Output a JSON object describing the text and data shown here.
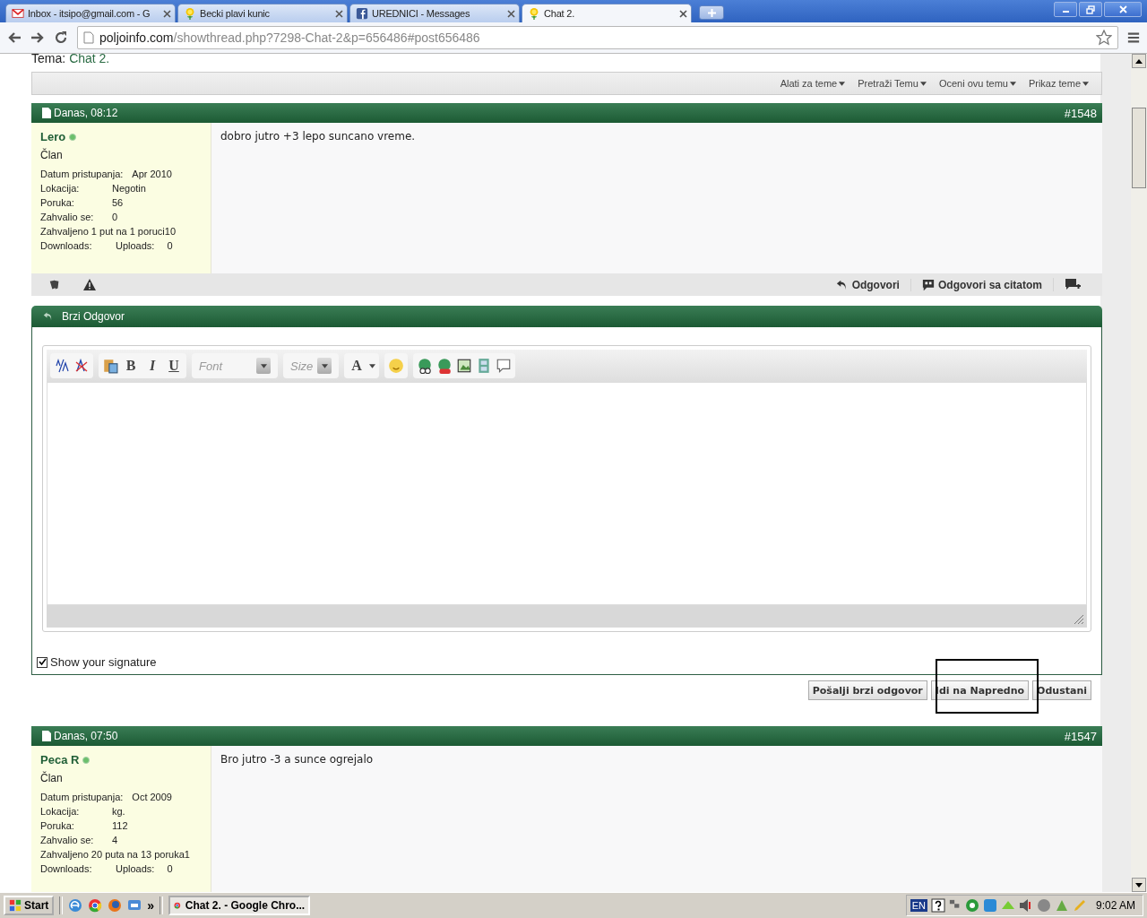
{
  "browser": {
    "tabs": [
      {
        "title": "Inbox - itsipo@gmail.com - G",
        "kind": "mail",
        "selected": false
      },
      {
        "title": "Becki plavi kunic",
        "kind": "flower",
        "selected": false
      },
      {
        "title": "UREDNICI - Messages",
        "kind": "facebook",
        "selected": false
      },
      {
        "title": "Chat 2.",
        "kind": "flower",
        "selected": true
      }
    ],
    "address": {
      "domain": "poljoinfo.com",
      "path": "/showthread.php?7298-Chat-2&p=656486#post656486"
    }
  },
  "thread": {
    "label": "Tema:",
    "title": "Chat 2."
  },
  "thread_tools": [
    "Alati za teme",
    "Pretraži Temu",
    "Oceni ovu temu",
    "Prikaz teme"
  ],
  "posts": [
    {
      "date": "Danas, 08:12",
      "number": "#1548",
      "author": "Lero",
      "online": true,
      "rank": "Član",
      "stats": [
        [
          "Datum pristupanja:",
          "Apr 2010"
        ],
        [
          "Lokacija:",
          "Negotin"
        ],
        [
          "Poruka:",
          "56"
        ],
        [
          "Zahvalio se:",
          "0"
        ],
        [
          "Zahvaljeno 1 put na 1 poruci10"
        ],
        [
          "Downloads:",
          "Uploads:",
          "0"
        ]
      ],
      "message": "dobro jutro +3 lepo suncano vreme.",
      "actions": [
        "Odgovori",
        "Odgovori sa citatom"
      ]
    },
    {
      "date": "Danas, 07:50",
      "number": "#1547",
      "author": "Peca R",
      "online": true,
      "rank": "Član",
      "stats": [
        [
          "Datum pristupanja:",
          "Oct 2009"
        ],
        [
          "Lokacija:",
          "kg."
        ],
        [
          "Poruka:",
          "112"
        ],
        [
          "Zahvalio se:",
          "4"
        ],
        [
          "Zahvaljeno 20 puta na 13 poruka1"
        ],
        [
          "Downloads:",
          "Uploads:",
          "0"
        ]
      ],
      "message": "Bro jutro -3 a sunce ogrejalo"
    }
  ],
  "quick_reply": {
    "title": "Brzi Odgovor",
    "format_buttons": [
      "B",
      "I",
      "U"
    ],
    "font_placeholder": "Font",
    "size_placeholder": "Size",
    "color_button": "A",
    "show_signature": {
      "label": "Show your signature",
      "checked": true
    },
    "buttons": [
      "Pošalji brzi odgovor",
      "Idi na Napredno",
      "Odustani"
    ]
  },
  "taskbar": {
    "start": "Start",
    "overflow": "»",
    "task": "Chat 2. - Google Chro...",
    "language": "EN",
    "time": "9:02 AM"
  }
}
